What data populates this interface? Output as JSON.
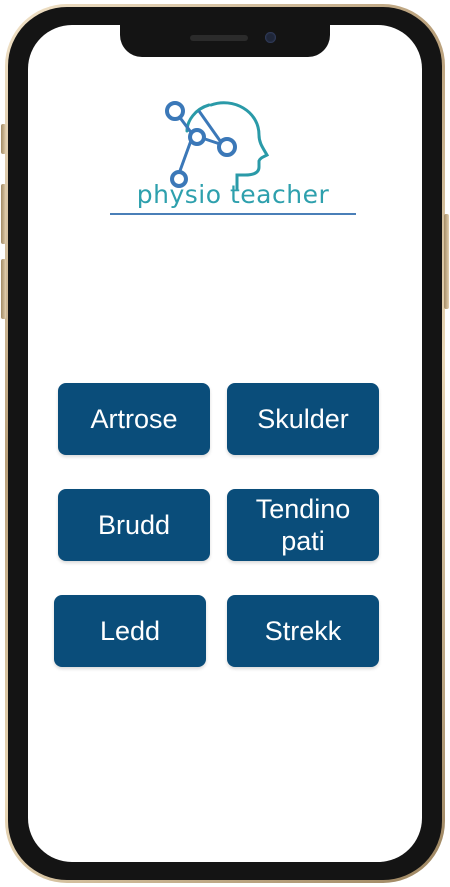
{
  "app": {
    "logo_text": "physio teacher"
  },
  "topics": [
    {
      "label": "Artrose"
    },
    {
      "label": "Skulder"
    },
    {
      "label": "Brudd"
    },
    {
      "label": "Tendinopati"
    },
    {
      "label": "Ledd"
    },
    {
      "label": "Strekk"
    }
  ],
  "colors": {
    "tile_background": "#0a4d7a",
    "tile_text": "#ffffff",
    "logo_text": "#2ea0ad",
    "logo_underline": "#4a7fb8"
  },
  "icons": {
    "logo": "head-network-icon"
  }
}
